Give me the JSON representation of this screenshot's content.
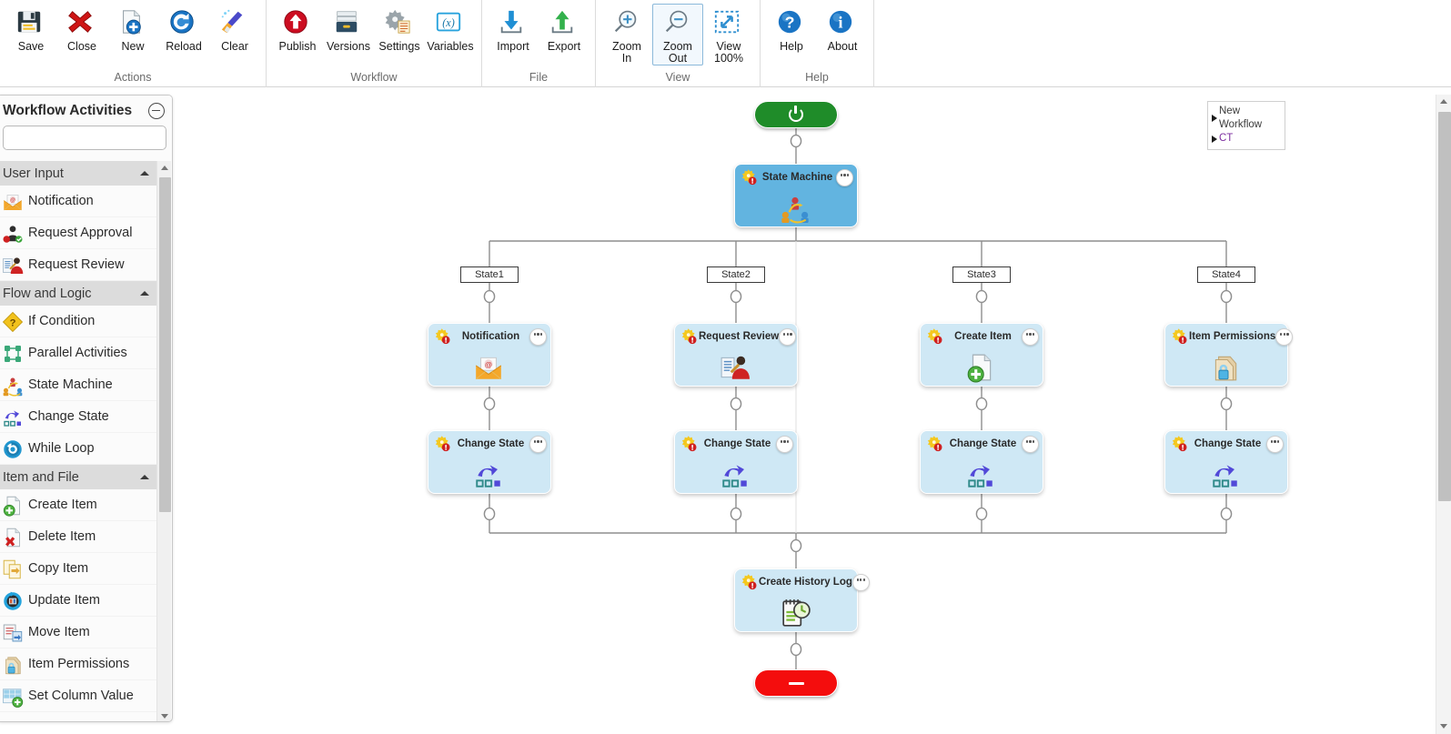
{
  "ribbon": {
    "groups": [
      {
        "label": "Actions",
        "buttons": [
          {
            "label": "Save",
            "icon": "save-icon"
          },
          {
            "label": "Close",
            "icon": "close-x-icon"
          },
          {
            "label": "New",
            "icon": "new-document-icon"
          },
          {
            "label": "Reload",
            "icon": "reload-icon"
          },
          {
            "label": "Clear",
            "icon": "clear-broom-icon"
          }
        ]
      },
      {
        "label": "Workflow",
        "buttons": [
          {
            "label": "Publish",
            "icon": "publish-up-arrow-icon"
          },
          {
            "label": "Versions",
            "icon": "versions-drawer-icon"
          },
          {
            "label": "Settings",
            "icon": "settings-gear-icon"
          },
          {
            "label": "Variables",
            "icon": "variables-x-icon"
          }
        ]
      },
      {
        "label": "File",
        "buttons": [
          {
            "label": "Import",
            "icon": "import-down-arrow-icon"
          },
          {
            "label": "Export",
            "icon": "export-up-arrow-icon"
          }
        ]
      },
      {
        "label": "View",
        "buttons": [
          {
            "label": "Zoom\nIn",
            "icon": "zoom-in-icon"
          },
          {
            "label": "Zoom\nOut",
            "icon": "zoom-out-icon",
            "selected": true
          },
          {
            "label": "View\n100%",
            "icon": "view-fit-icon"
          }
        ]
      },
      {
        "label": "Help",
        "buttons": [
          {
            "label": "Help",
            "icon": "help-question-icon"
          },
          {
            "label": "About",
            "icon": "about-info-icon"
          }
        ]
      }
    ]
  },
  "sidebar": {
    "title": "Workflow Activities",
    "collapse_icon": "collapse-circle-minus-icon",
    "search": {
      "value": "",
      "placeholder": "",
      "icon": "search-icon"
    },
    "groups": [
      {
        "label": "User Input",
        "expanded": true,
        "items": [
          {
            "label": "Notification",
            "icon": "notification-envelope-icon"
          },
          {
            "label": "Request Approval",
            "icon": "request-approval-icon"
          },
          {
            "label": "Request Review",
            "icon": "request-review-icon"
          }
        ]
      },
      {
        "label": "Flow and Logic",
        "expanded": true,
        "items": [
          {
            "label": "If Condition",
            "icon": "if-condition-diamond-icon"
          },
          {
            "label": "Parallel Activities",
            "icon": "parallel-activities-icon"
          },
          {
            "label": "State Machine",
            "icon": "state-machine-icon"
          },
          {
            "label": "Change State",
            "icon": "change-state-icon"
          },
          {
            "label": "While Loop",
            "icon": "while-loop-icon"
          }
        ]
      },
      {
        "label": "Item and File",
        "expanded": true,
        "items": [
          {
            "label": "Create Item",
            "icon": "create-item-icon"
          },
          {
            "label": "Delete Item",
            "icon": "delete-item-icon"
          },
          {
            "label": "Copy Item",
            "icon": "copy-item-icon"
          },
          {
            "label": "Update Item",
            "icon": "update-item-icon"
          },
          {
            "label": "Move Item",
            "icon": "move-item-icon"
          },
          {
            "label": "Item Permissions",
            "icon": "item-permissions-icon"
          },
          {
            "label": "Set Column Value",
            "icon": "set-column-value-icon"
          }
        ]
      }
    ]
  },
  "canvas": {
    "legend": {
      "rows": [
        {
          "label": "New Workflow",
          "color": "#3b3b3b"
        },
        {
          "label": "CT",
          "color": "#7d2fa0"
        }
      ]
    },
    "start_node": {
      "icon": "power-start-icon",
      "color": "#1f8c29"
    },
    "end_node": {
      "icon": "stop-minus-icon",
      "color": "#f40d0d"
    },
    "root": {
      "title": "State Machine",
      "icon": "state-machine-icon",
      "badge": "gear-error-badge",
      "menu": "ellipsis-menu-icon"
    },
    "states": [
      {
        "name": "State1"
      },
      {
        "name": "State2"
      },
      {
        "name": "State3"
      },
      {
        "name": "State4"
      }
    ],
    "activity_rows": [
      [
        {
          "title": "Notification",
          "icon": "notification-envelope-icon"
        },
        {
          "title": "Request Review",
          "icon": "request-review-icon"
        },
        {
          "title": "Create Item",
          "icon": "create-item-icon"
        },
        {
          "title": "Item Permissions",
          "icon": "item-permissions-icon"
        }
      ],
      [
        {
          "title": "Change State",
          "icon": "change-state-icon"
        },
        {
          "title": "Change State",
          "icon": "change-state-icon"
        },
        {
          "title": "Change State",
          "icon": "change-state-icon"
        },
        {
          "title": "Change State",
          "icon": "change-state-icon"
        }
      ]
    ],
    "final_node": {
      "title": "Create History Log",
      "icon": "create-history-log-icon"
    }
  },
  "colors": {
    "node_fill": "#cfe8f5",
    "root_fill": "#62b4e0",
    "start_green": "#1f8c29",
    "end_red": "#f40d0d",
    "group_header": "#dcdcdc"
  }
}
